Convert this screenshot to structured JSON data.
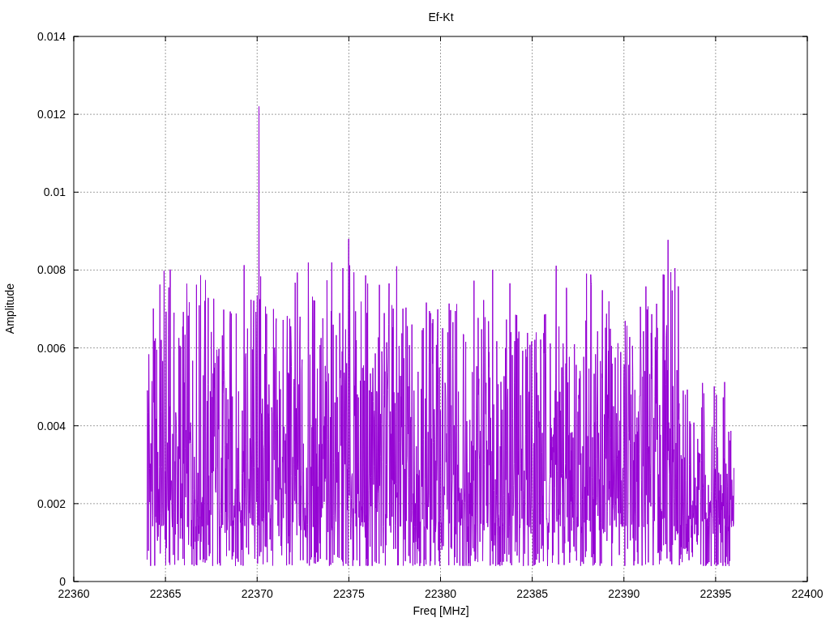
{
  "title": "Ef-Kt",
  "xlabel": "Freq [MHz]",
  "ylabel": "Amplitude",
  "xticks": [
    "22360",
    "22365",
    "22370",
    "22375",
    "22380",
    "22385",
    "22390",
    "22395",
    "22400"
  ],
  "yticks": [
    "0.014",
    "0.012",
    "0.01",
    "0.008",
    "0.006",
    "0.004",
    "0.002",
    "0"
  ]
}
